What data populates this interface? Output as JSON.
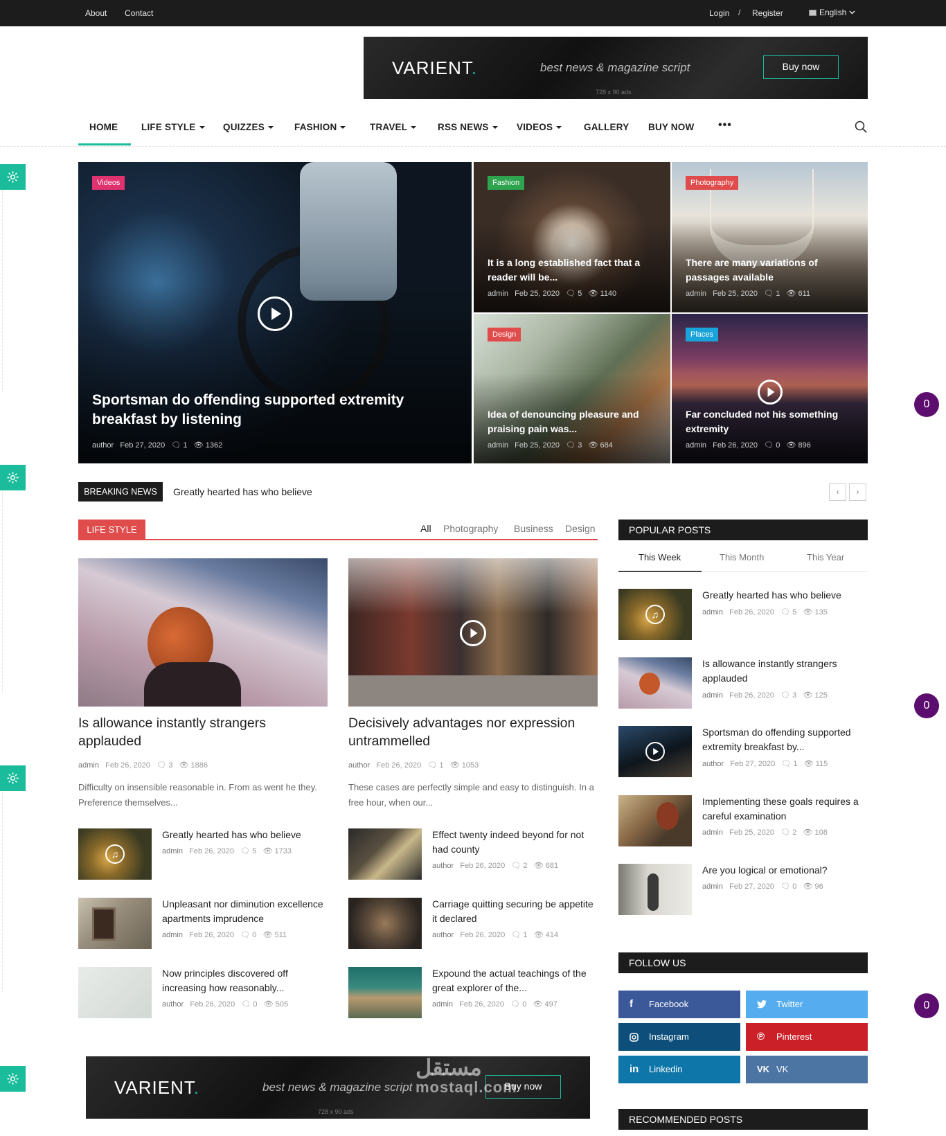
{
  "topbar": {
    "about": "About",
    "contact": "Contact",
    "login": "Login",
    "separator": "/",
    "register": "Register",
    "language": "English"
  },
  "header_ad": {
    "logo": "VARIENT",
    "logo_dot": ".",
    "tagline": "best news & magazine script",
    "button": "Buy now",
    "size": "728 x 90 ads"
  },
  "nav": {
    "items": [
      {
        "label": "HOME",
        "dropdown": false
      },
      {
        "label": "LIFE STYLE",
        "dropdown": true
      },
      {
        "label": "QUIZZES",
        "dropdown": true
      },
      {
        "label": "FASHION",
        "dropdown": true
      },
      {
        "label": "TRAVEL",
        "dropdown": true
      },
      {
        "label": "RSS NEWS",
        "dropdown": true
      },
      {
        "label": "VIDEOS",
        "dropdown": true
      },
      {
        "label": "GALLERY",
        "dropdown": false
      },
      {
        "label": "BUY NOW",
        "dropdown": false
      }
    ],
    "more": "•••",
    "accent_color": "#1abc9c"
  },
  "slider": {
    "main": {
      "category": "Videos",
      "category_color": "#e0326e",
      "title": "Sportsman do offending supported extremity breakfast by listening",
      "author": "author",
      "date": "Feb 27, 2020",
      "comments": "1",
      "views": "1362"
    },
    "tiles": [
      {
        "category": "Fashion",
        "category_color": "#2ea44f",
        "title": "It is a long established fact that a reader will be...",
        "author": "admin",
        "date": "Feb 25, 2020",
        "comments": "5",
        "views": "1140"
      },
      {
        "category": "Photography",
        "category_color": "#e04b4b",
        "title": "There are many variations of passages available",
        "author": "admin",
        "date": "Feb 25, 2020",
        "comments": "1",
        "views": "611"
      },
      {
        "category": "Design",
        "category_color": "#e04b4b",
        "title": "Idea of denouncing pleasure and praising pain was...",
        "author": "admin",
        "date": "Feb 25, 2020",
        "comments": "3",
        "views": "684"
      },
      {
        "category": "Places",
        "category_color": "#1aa3d9",
        "title": "Far concluded not his something extremity",
        "author": "admin",
        "date": "Feb 26, 2020",
        "comments": "0",
        "views": "896"
      }
    ]
  },
  "breaking": {
    "label": "BREAKING NEWS",
    "text": "Greatly hearted has who believe",
    "prev": "‹",
    "next": "›"
  },
  "lifestyle": {
    "label": "LIFE STYLE",
    "filters": [
      "All",
      "Photography",
      "Business",
      "Design"
    ],
    "featured": [
      {
        "title": "Is allowance instantly strangers applauded",
        "author": "admin",
        "date": "Feb 26, 2020",
        "comments": "3",
        "views": "1886",
        "excerpt": "Difficulty on insensible reasonable in. From as went he they. Preference themselves..."
      },
      {
        "title": "Decisively advantages nor expression untrammelled",
        "author": "author",
        "date": "Feb 26, 2020",
        "comments": "1",
        "views": "1053",
        "excerpt": "These cases are perfectly simple and easy to distinguish. In a free hour, when our..."
      }
    ],
    "left_list": [
      {
        "title": "Greatly hearted has who believe",
        "author": "admin",
        "date": "Feb 26, 2020",
        "comments": "5",
        "views": "1733"
      },
      {
        "title": "Unpleasant nor diminution excellence apartments imprudence",
        "author": "admin",
        "date": "Feb 26, 2020",
        "comments": "0",
        "views": "511"
      },
      {
        "title": "Now principles discovered off increasing how reasonably...",
        "author": "author",
        "date": "Feb 26, 2020",
        "comments": "0",
        "views": "505"
      }
    ],
    "right_list": [
      {
        "title": "Effect twenty indeed beyond for not had county",
        "author": "author",
        "date": "Feb 26, 2020",
        "comments": "2",
        "views": "681"
      },
      {
        "title": "Carriage quitting securing be appetite it declared",
        "author": "author",
        "date": "Feb 26, 2020",
        "comments": "1",
        "views": "414"
      },
      {
        "title": "Expound the actual teachings of the great explorer of the...",
        "author": "admin",
        "date": "Feb 26, 2020",
        "comments": "0",
        "views": "497"
      }
    ]
  },
  "popular": {
    "label": "POPULAR POSTS",
    "tabs": [
      "This Week",
      "This Month",
      "This Year"
    ],
    "posts": [
      {
        "title": "Greatly hearted has who believe",
        "author": "admin",
        "date": "Feb 26, 2020",
        "comments": "5",
        "views": "135"
      },
      {
        "title": "Is allowance instantly strangers applauded",
        "author": "admin",
        "date": "Feb 26, 2020",
        "comments": "3",
        "views": "125"
      },
      {
        "title": "Sportsman do offending supported extremity breakfast by...",
        "author": "author",
        "date": "Feb 27, 2020",
        "comments": "1",
        "views": "115"
      },
      {
        "title": "Implementing these goals requires a careful examination",
        "author": "admin",
        "date": "Feb 25, 2020",
        "comments": "2",
        "views": "108"
      },
      {
        "title": "Are you logical or emotional?",
        "author": "admin",
        "date": "Feb 27, 2020",
        "comments": "0",
        "views": "96"
      }
    ]
  },
  "follow": {
    "label": "FOLLOW US",
    "networks": [
      {
        "name": "Facebook",
        "color": "#3b5998",
        "icon": "f"
      },
      {
        "name": "Twitter",
        "color": "#55acee",
        "icon": "t"
      },
      {
        "name": "Instagram",
        "color": "#0d4f7a",
        "icon": "ig"
      },
      {
        "name": "Pinterest",
        "color": "#cb2027",
        "icon": "p"
      },
      {
        "name": "Linkedin",
        "color": "#0e76a8",
        "icon": "in"
      },
      {
        "name": "VK",
        "color": "#4c75a3",
        "icon": "vk"
      }
    ]
  },
  "recommended": {
    "label": "RECOMMENDED POSTS"
  },
  "footer_ad": {
    "logo": "VARIENT",
    "logo_dot": ".",
    "tagline": "best news & magazine script",
    "button": "Buy now",
    "size": "728 x 90 ads"
  },
  "widgets": {
    "counter": "0"
  },
  "watermark": {
    "line1": "مستقل",
    "line2": "mostaql.com"
  }
}
